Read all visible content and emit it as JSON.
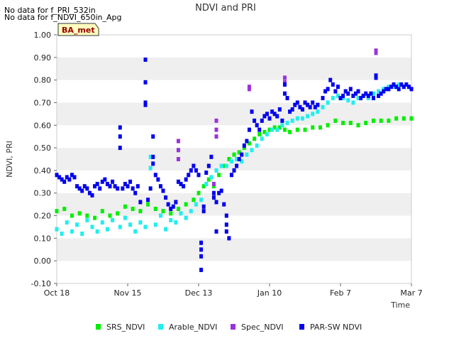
{
  "notes": [
    "No data for f_PRI_532in",
    "No data for f_NDVI_650in_Apg"
  ],
  "site_badge": "BA_met",
  "colors": {
    "SRS_NDVI": "#00ee00",
    "Arable_NDVI": "#22eeee",
    "Spec_NDVI": "#9933dd",
    "PAR-SW NDVI": "#0000ee",
    "band": "#efefef",
    "badge_fill": "#ffffc0",
    "badge_text": "#990000"
  },
  "chart_data": {
    "type": "scatter",
    "title": "NDVI and PRI",
    "xlabel": "Time",
    "ylabel": "NDVI, PRI",
    "x_range_days": [
      0,
      140
    ],
    "ylim": [
      -0.1,
      1.0
    ],
    "x_ticks": [
      {
        "label": "Oct 18",
        "day": 0
      },
      {
        "label": "Nov 15",
        "day": 28
      },
      {
        "label": "Dec 13",
        "day": 56
      },
      {
        "label": "Jan 10",
        "day": 84
      },
      {
        "label": "Feb 7",
        "day": 112
      },
      {
        "label": "Mar 7",
        "day": 140
      }
    ],
    "y_ticks": [
      "-0.10",
      "0.00",
      "0.10",
      "0.20",
      "0.30",
      "0.40",
      "0.50",
      "0.60",
      "0.70",
      "0.80",
      "0.90",
      "1.00"
    ],
    "grid": "alternating horizontal bands",
    "legend": "bottom",
    "series": [
      {
        "name": "SRS_NDVI",
        "points": [
          [
            0,
            0.22
          ],
          [
            3,
            0.23
          ],
          [
            6,
            0.2
          ],
          [
            9,
            0.21
          ],
          [
            12,
            0.2
          ],
          [
            15,
            0.19
          ],
          [
            18,
            0.22
          ],
          [
            21,
            0.2
          ],
          [
            24,
            0.21
          ],
          [
            27,
            0.24
          ],
          [
            30,
            0.23
          ],
          [
            33,
            0.22
          ],
          [
            36,
            0.25
          ],
          [
            39,
            0.23
          ],
          [
            42,
            0.22
          ],
          [
            45,
            0.21
          ],
          [
            48,
            0.23
          ],
          [
            51,
            0.25
          ],
          [
            54,
            0.27
          ],
          [
            56,
            0.3
          ],
          [
            58,
            0.33
          ],
          [
            60,
            0.36
          ],
          [
            62,
            0.33
          ],
          [
            64,
            0.38
          ],
          [
            66,
            0.42
          ],
          [
            68,
            0.45
          ],
          [
            70,
            0.47
          ],
          [
            72,
            0.48
          ],
          [
            74,
            0.5
          ],
          [
            76,
            0.52
          ],
          [
            78,
            0.54
          ],
          [
            80,
            0.56
          ],
          [
            82,
            0.57
          ],
          [
            84,
            0.58
          ],
          [
            86,
            0.59
          ],
          [
            88,
            0.59
          ],
          [
            90,
            0.58
          ],
          [
            92,
            0.57
          ],
          [
            95,
            0.58
          ],
          [
            98,
            0.58
          ],
          [
            101,
            0.59
          ],
          [
            104,
            0.59
          ],
          [
            107,
            0.6
          ],
          [
            110,
            0.62
          ],
          [
            113,
            0.61
          ],
          [
            116,
            0.61
          ],
          [
            119,
            0.6
          ],
          [
            122,
            0.61
          ],
          [
            125,
            0.62
          ],
          [
            128,
            0.62
          ],
          [
            131,
            0.62
          ],
          [
            134,
            0.63
          ],
          [
            137,
            0.63
          ],
          [
            140,
            0.63
          ]
        ]
      },
      {
        "name": "Arable_NDVI",
        "points": [
          [
            0,
            0.14
          ],
          [
            2,
            0.12
          ],
          [
            4,
            0.17
          ],
          [
            6,
            0.13
          ],
          [
            8,
            0.16
          ],
          [
            10,
            0.12
          ],
          [
            12,
            0.18
          ],
          [
            14,
            0.15
          ],
          [
            16,
            0.13
          ],
          [
            18,
            0.17
          ],
          [
            20,
            0.14
          ],
          [
            22,
            0.18
          ],
          [
            25,
            0.15
          ],
          [
            27,
            0.19
          ],
          [
            29,
            0.16
          ],
          [
            31,
            0.13
          ],
          [
            33,
            0.17
          ],
          [
            35,
            0.15
          ],
          [
            37,
            0.41
          ],
          [
            37,
            0.46
          ],
          [
            39,
            0.16
          ],
          [
            41,
            0.2
          ],
          [
            43,
            0.14
          ],
          [
            45,
            0.18
          ],
          [
            47,
            0.17
          ],
          [
            49,
            0.21
          ],
          [
            51,
            0.19
          ],
          [
            53,
            0.22
          ],
          [
            55,
            0.25
          ],
          [
            57,
            0.27
          ],
          [
            59,
            0.34
          ],
          [
            61,
            0.37
          ],
          [
            63,
            0.4
          ],
          [
            65,
            0.42
          ],
          [
            67,
            0.42
          ],
          [
            69,
            0.44
          ],
          [
            71,
            0.45
          ],
          [
            73,
            0.44
          ],
          [
            75,
            0.47
          ],
          [
            77,
            0.49
          ],
          [
            79,
            0.51
          ],
          [
            81,
            0.54
          ],
          [
            83,
            0.56
          ],
          [
            85,
            0.58
          ],
          [
            87,
            0.58
          ],
          [
            89,
            0.6
          ],
          [
            91,
            0.61
          ],
          [
            93,
            0.62
          ],
          [
            95,
            0.63
          ],
          [
            97,
            0.63
          ],
          [
            99,
            0.64
          ],
          [
            101,
            0.65
          ],
          [
            103,
            0.66
          ],
          [
            105,
            0.68
          ],
          [
            107,
            0.7
          ],
          [
            109,
            0.72
          ],
          [
            111,
            0.73
          ],
          [
            113,
            0.72
          ],
          [
            115,
            0.71
          ],
          [
            117,
            0.7
          ],
          [
            119,
            0.72
          ],
          [
            121,
            0.73
          ],
          [
            123,
            0.72
          ],
          [
            125,
            0.74
          ],
          [
            127,
            0.75
          ],
          [
            129,
            0.76
          ],
          [
            131,
            0.77
          ],
          [
            133,
            0.77
          ],
          [
            135,
            0.78
          ],
          [
            137,
            0.77
          ],
          [
            139,
            0.77
          ]
        ]
      },
      {
        "name": "Spec_NDVI",
        "points": [
          [
            48,
            0.53
          ],
          [
            48,
            0.49
          ],
          [
            48,
            0.45
          ],
          [
            62,
            0.34
          ],
          [
            63,
            0.62
          ],
          [
            63,
            0.58
          ],
          [
            63,
            0.55
          ],
          [
            76,
            0.77
          ],
          [
            76,
            0.76
          ],
          [
            90,
            0.81
          ],
          [
            90,
            0.79
          ],
          [
            126,
            0.93
          ],
          [
            126,
            0.92
          ]
        ]
      },
      {
        "name": "PAR-SW NDVI",
        "points": [
          [
            0,
            0.38
          ],
          [
            1,
            0.37
          ],
          [
            2,
            0.36
          ],
          [
            3,
            0.35
          ],
          [
            4,
            0.37
          ],
          [
            5,
            0.36
          ],
          [
            6,
            0.38
          ],
          [
            7,
            0.37
          ],
          [
            8,
            0.33
          ],
          [
            9,
            0.32
          ],
          [
            10,
            0.31
          ],
          [
            11,
            0.33
          ],
          [
            12,
            0.32
          ],
          [
            13,
            0.3
          ],
          [
            14,
            0.29
          ],
          [
            15,
            0.33
          ],
          [
            16,
            0.34
          ],
          [
            17,
            0.32
          ],
          [
            18,
            0.35
          ],
          [
            19,
            0.36
          ],
          [
            20,
            0.34
          ],
          [
            21,
            0.33
          ],
          [
            22,
            0.35
          ],
          [
            23,
            0.33
          ],
          [
            24,
            0.32
          ],
          [
            25,
            0.59
          ],
          [
            25,
            0.55
          ],
          [
            25,
            0.5
          ],
          [
            26,
            0.32
          ],
          [
            27,
            0.34
          ],
          [
            28,
            0.33
          ],
          [
            29,
            0.35
          ],
          [
            30,
            0.32
          ],
          [
            31,
            0.3
          ],
          [
            32,
            0.33
          ],
          [
            33,
            0.26
          ],
          [
            35,
            0.89
          ],
          [
            35,
            0.79
          ],
          [
            35,
            0.7
          ],
          [
            35,
            0.69
          ],
          [
            36,
            0.27
          ],
          [
            37,
            0.32
          ],
          [
            38,
            0.55
          ],
          [
            38,
            0.46
          ],
          [
            38,
            0.43
          ],
          [
            39,
            0.38
          ],
          [
            40,
            0.36
          ],
          [
            41,
            0.33
          ],
          [
            42,
            0.31
          ],
          [
            43,
            0.28
          ],
          [
            44,
            0.25
          ],
          [
            45,
            0.23
          ],
          [
            46,
            0.24
          ],
          [
            47,
            0.26
          ],
          [
            48,
            0.35
          ],
          [
            49,
            0.34
          ],
          [
            50,
            0.33
          ],
          [
            51,
            0.36
          ],
          [
            52,
            0.38
          ],
          [
            53,
            0.4
          ],
          [
            54,
            0.42
          ],
          [
            55,
            0.4
          ],
          [
            56,
            0.38
          ],
          [
            57,
            0.08
          ],
          [
            57,
            0.05
          ],
          [
            57,
            0.02
          ],
          [
            57,
            -0.04
          ],
          [
            58,
            0.24
          ],
          [
            58,
            0.22
          ],
          [
            59,
            0.39
          ],
          [
            60,
            0.42
          ],
          [
            61,
            0.46
          ],
          [
            62,
            0.3
          ],
          [
            62,
            0.28
          ],
          [
            63,
            0.26
          ],
          [
            63,
            0.13
          ],
          [
            64,
            0.3
          ],
          [
            65,
            0.31
          ],
          [
            66,
            0.25
          ],
          [
            67,
            0.2
          ],
          [
            67,
            0.16
          ],
          [
            67,
            0.13
          ],
          [
            68,
            0.1
          ],
          [
            69,
            0.38
          ],
          [
            70,
            0.4
          ],
          [
            71,
            0.42
          ],
          [
            72,
            0.45
          ],
          [
            73,
            0.47
          ],
          [
            74,
            0.51
          ],
          [
            75,
            0.53
          ],
          [
            76,
            0.58
          ],
          [
            77,
            0.66
          ],
          [
            78,
            0.62
          ],
          [
            79,
            0.6
          ],
          [
            80,
            0.58
          ],
          [
            81,
            0.62
          ],
          [
            82,
            0.64
          ],
          [
            83,
            0.65
          ],
          [
            84,
            0.63
          ],
          [
            85,
            0.66
          ],
          [
            86,
            0.65
          ],
          [
            87,
            0.64
          ],
          [
            88,
            0.67
          ],
          [
            89,
            0.62
          ],
          [
            90,
            0.78
          ],
          [
            90,
            0.74
          ],
          [
            91,
            0.72
          ],
          [
            92,
            0.66
          ],
          [
            93,
            0.67
          ],
          [
            94,
            0.69
          ],
          [
            95,
            0.7
          ],
          [
            96,
            0.68
          ],
          [
            97,
            0.67
          ],
          [
            98,
            0.7
          ],
          [
            99,
            0.69
          ],
          [
            100,
            0.68
          ],
          [
            101,
            0.7
          ],
          [
            102,
            0.68
          ],
          [
            103,
            0.69
          ],
          [
            105,
            0.72
          ],
          [
            106,
            0.75
          ],
          [
            107,
            0.76
          ],
          [
            108,
            0.8
          ],
          [
            109,
            0.78
          ],
          [
            110,
            0.75
          ],
          [
            111,
            0.77
          ],
          [
            112,
            0.72
          ],
          [
            113,
            0.73
          ],
          [
            114,
            0.75
          ],
          [
            115,
            0.74
          ],
          [
            116,
            0.76
          ],
          [
            117,
            0.73
          ],
          [
            118,
            0.74
          ],
          [
            119,
            0.75
          ],
          [
            120,
            0.72
          ],
          [
            121,
            0.73
          ],
          [
            122,
            0.74
          ],
          [
            123,
            0.73
          ],
          [
            124,
            0.74
          ],
          [
            125,
            0.72
          ],
          [
            126,
            0.82
          ],
          [
            126,
            0.81
          ],
          [
            127,
            0.73
          ],
          [
            128,
            0.74
          ],
          [
            129,
            0.75
          ],
          [
            130,
            0.76
          ],
          [
            131,
            0.76
          ],
          [
            132,
            0.77
          ],
          [
            133,
            0.78
          ],
          [
            134,
            0.77
          ],
          [
            135,
            0.76
          ],
          [
            136,
            0.78
          ],
          [
            137,
            0.77
          ],
          [
            138,
            0.78
          ],
          [
            139,
            0.77
          ],
          [
            140,
            0.76
          ]
        ]
      }
    ]
  }
}
